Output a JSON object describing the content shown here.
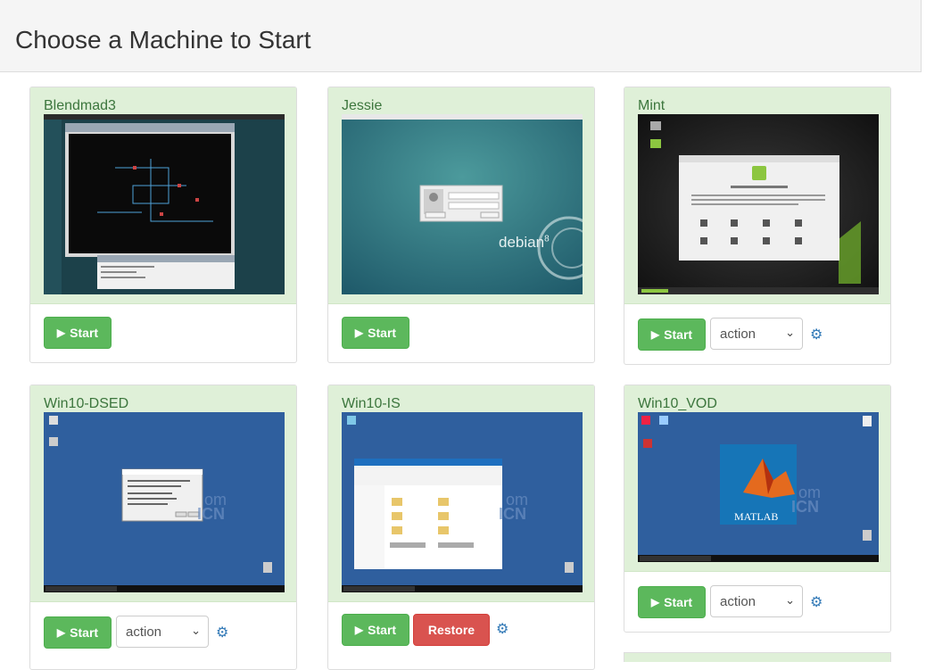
{
  "page": {
    "title": "Choose a Machine to Start"
  },
  "machines": [
    {
      "name": "Blendmad3",
      "start_label": "Start"
    },
    {
      "name": "Jessie",
      "start_label": "Start",
      "os_logo_text": "debian",
      "os_logo_sup": "8"
    },
    {
      "name": "Mint",
      "start_label": "Start",
      "action_value": "action"
    },
    {
      "name": "Win10-DSED",
      "start_label": "Start",
      "action_value": "action"
    },
    {
      "name": "Win10-IS",
      "start_label": "Start",
      "restore_label": "Restore"
    },
    {
      "name": "Win10_VOD",
      "start_label": "Start",
      "action_value": "action",
      "app_logo_text": "MATLAB"
    }
  ],
  "icons": {
    "play": "play-icon",
    "gear": "gear-icon",
    "caret": "chevron-down-icon"
  },
  "colors": {
    "success": "#5cb85c",
    "danger": "#d9534f",
    "panel": "#dff0d8",
    "link": "#337ab7"
  }
}
